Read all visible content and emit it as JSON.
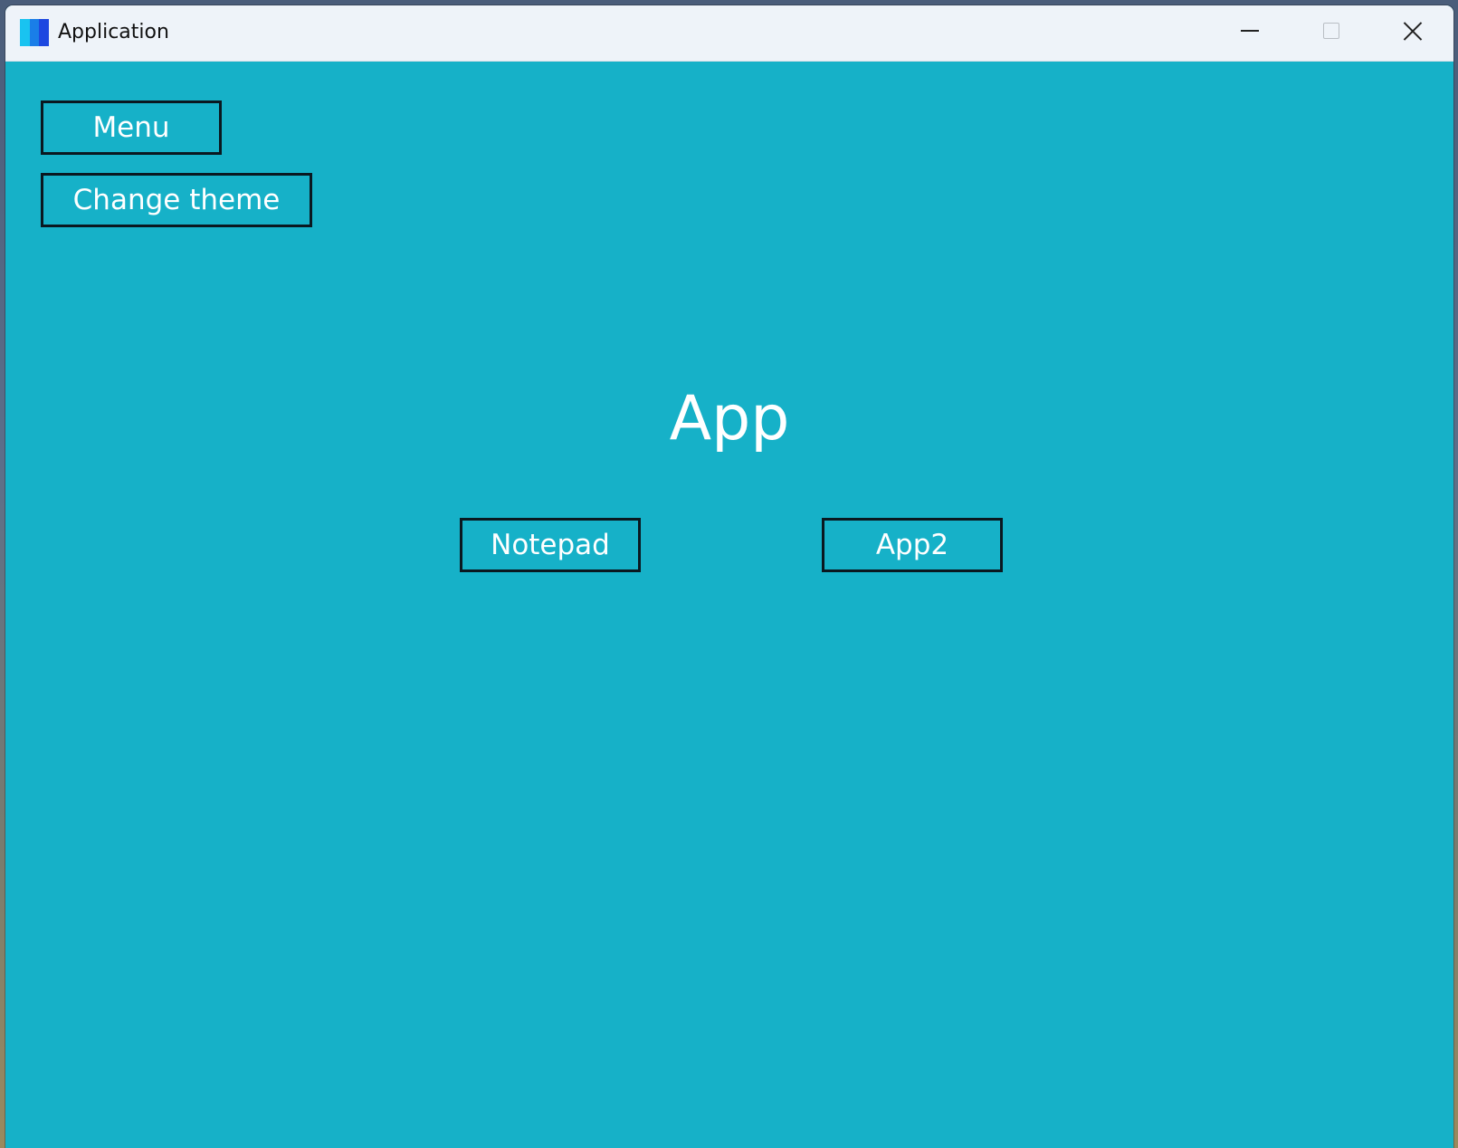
{
  "window": {
    "title": "Application",
    "background_color": "#16b1c8",
    "icon": "app-logo-icon",
    "controls": {
      "minimize_icon": "minimize-icon",
      "maximize_icon": "maximize-icon",
      "close_icon": "close-icon"
    }
  },
  "main": {
    "menu_label": "Menu",
    "change_theme_label": "Change theme",
    "heading": "App",
    "apps": [
      {
        "label": "Notepad"
      },
      {
        "label": "App2"
      }
    ]
  }
}
